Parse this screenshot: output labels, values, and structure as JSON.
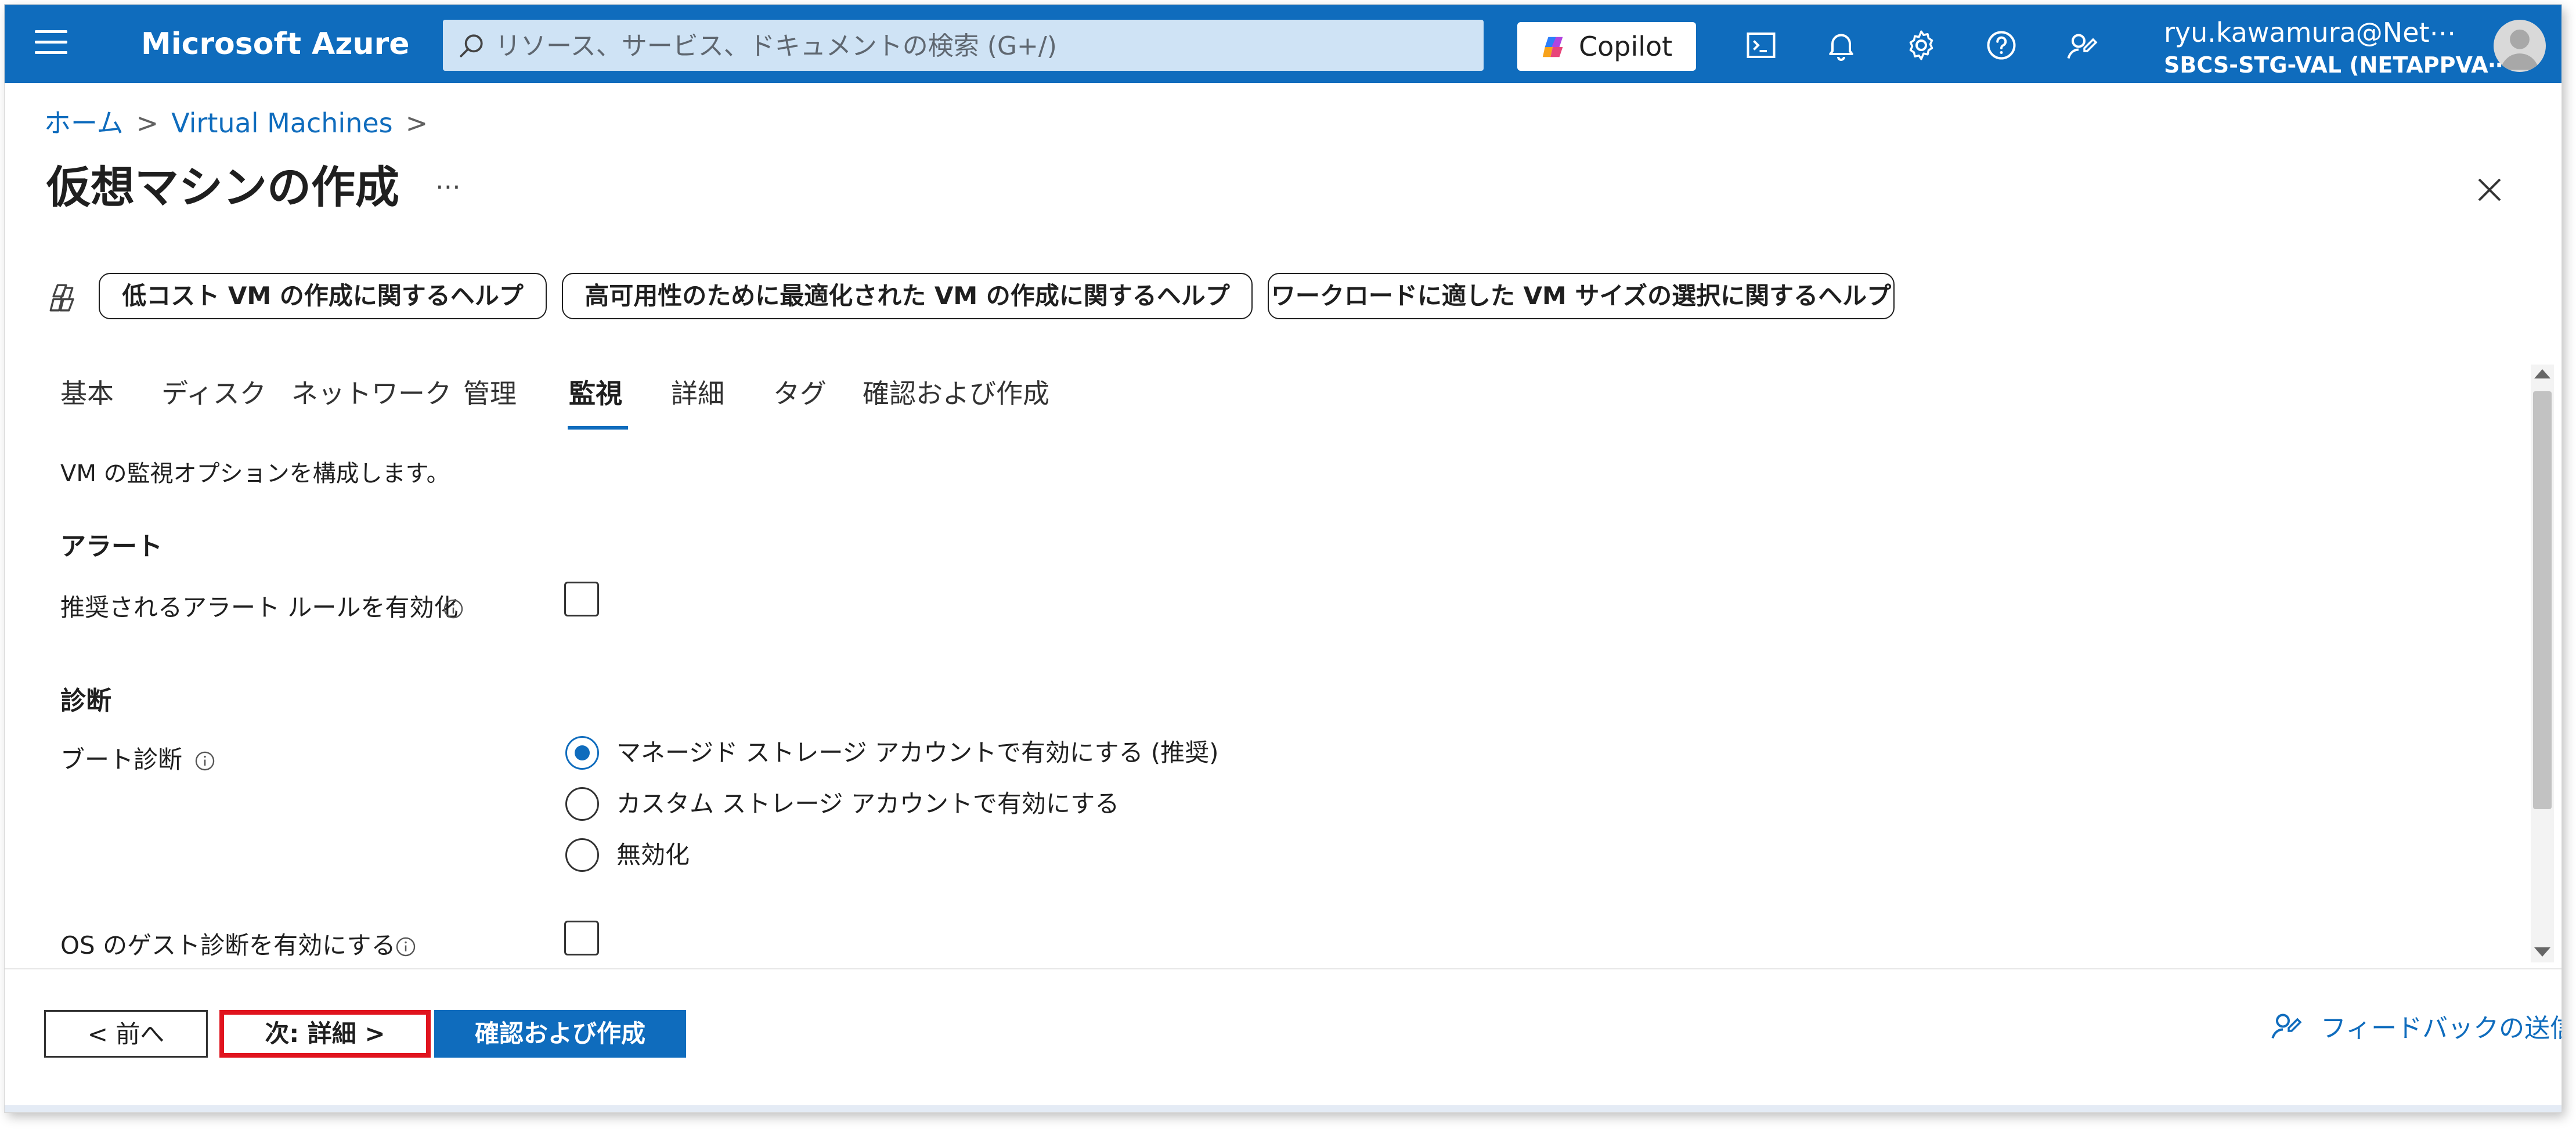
{
  "topbar": {
    "brand": "Microsoft Azure",
    "search_placeholder": "リソース、サービス、ドキュメントの検索 (G+/)",
    "copilot_label": "Copilot",
    "user_name": "ryu.kawamura@Net⋯",
    "user_tenant": "SBCS-STG-VAL (NETAPPVA⋯",
    "icons": [
      "hamburger-menu-icon",
      "search-icon",
      "copilot-icon",
      "cloud-shell-icon",
      "notifications-bell-icon",
      "settings-gear-icon",
      "help-question-icon",
      "feedback-person-icon",
      "avatar"
    ]
  },
  "breadcrumb": {
    "items": [
      "ホーム",
      "Virtual Machines"
    ]
  },
  "page": {
    "title": "仮想マシンの作成",
    "more_label": "⋯"
  },
  "help_chips": [
    "低コスト VM の作成に関するヘルプ",
    "高可用性のために最適化された VM の作成に関するヘルプ",
    "ワークロードに適した VM サイズの選択に関するヘルプ"
  ],
  "tabs": {
    "items": [
      "基本",
      "ディスク",
      "ネットワーク",
      "管理",
      "監視",
      "詳細",
      "タグ",
      "確認および作成"
    ],
    "active": "監視"
  },
  "content": {
    "intro": "VM の監視オプションを構成します。",
    "alerts": {
      "heading": "アラート",
      "label": "推奨されるアラート ルールを有効化",
      "checked": false
    },
    "diagnostics": {
      "heading": "診断",
      "boot_label": "ブート診断",
      "options": [
        "マネージド ストレージ アカウントで有効にする (推奨)",
        "カスタム ストレージ アカウントで有効にする",
        "無効化"
      ],
      "selected_index": 0,
      "guest_label": "OS のゲスト診断を有効にする",
      "guest_checked": false
    }
  },
  "footer": {
    "prev_label": "< 前へ",
    "next_label": "次: 詳細 >",
    "review_label": "確認および作成",
    "feedback_label": "フィードバックの送信"
  },
  "colors": {
    "accent": "#0f6cbd",
    "highlight_border": "#e0141e"
  }
}
